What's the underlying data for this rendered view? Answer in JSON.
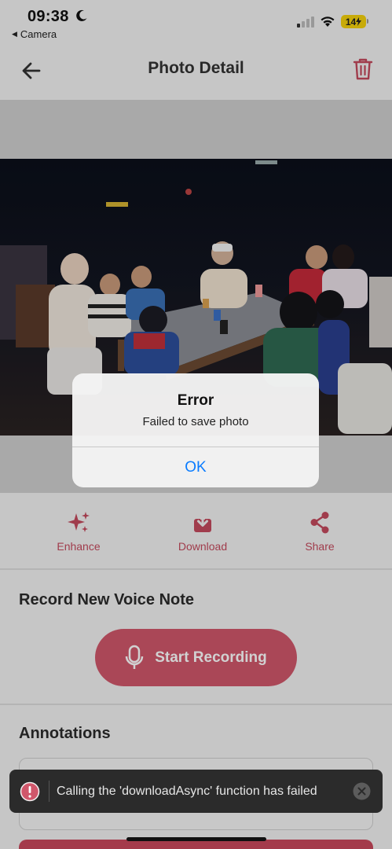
{
  "status_bar": {
    "time": "09:38",
    "back_app": "Camera",
    "battery": "14"
  },
  "header": {
    "title": "Photo Detail"
  },
  "actions": [
    {
      "label": "Enhance",
      "icon": "sparkles-icon"
    },
    {
      "label": "Download",
      "icon": "download-icon"
    },
    {
      "label": "Share",
      "icon": "share-icon"
    }
  ],
  "voice_note": {
    "title": "Record New Voice Note",
    "button_label": "Start Recording"
  },
  "annotations": {
    "title": "Annotations"
  },
  "alert": {
    "title": "Error",
    "message": "Failed to save photo",
    "ok_label": "OK"
  },
  "toast": {
    "message": "Calling the 'downloadAsync' function has failed"
  },
  "colors": {
    "accent": "#c44a5d",
    "record_button": "#d0576b",
    "alert_link": "#0a7cff",
    "toast_bg": "#2b2b2b",
    "error_icon": "#d0576b"
  }
}
